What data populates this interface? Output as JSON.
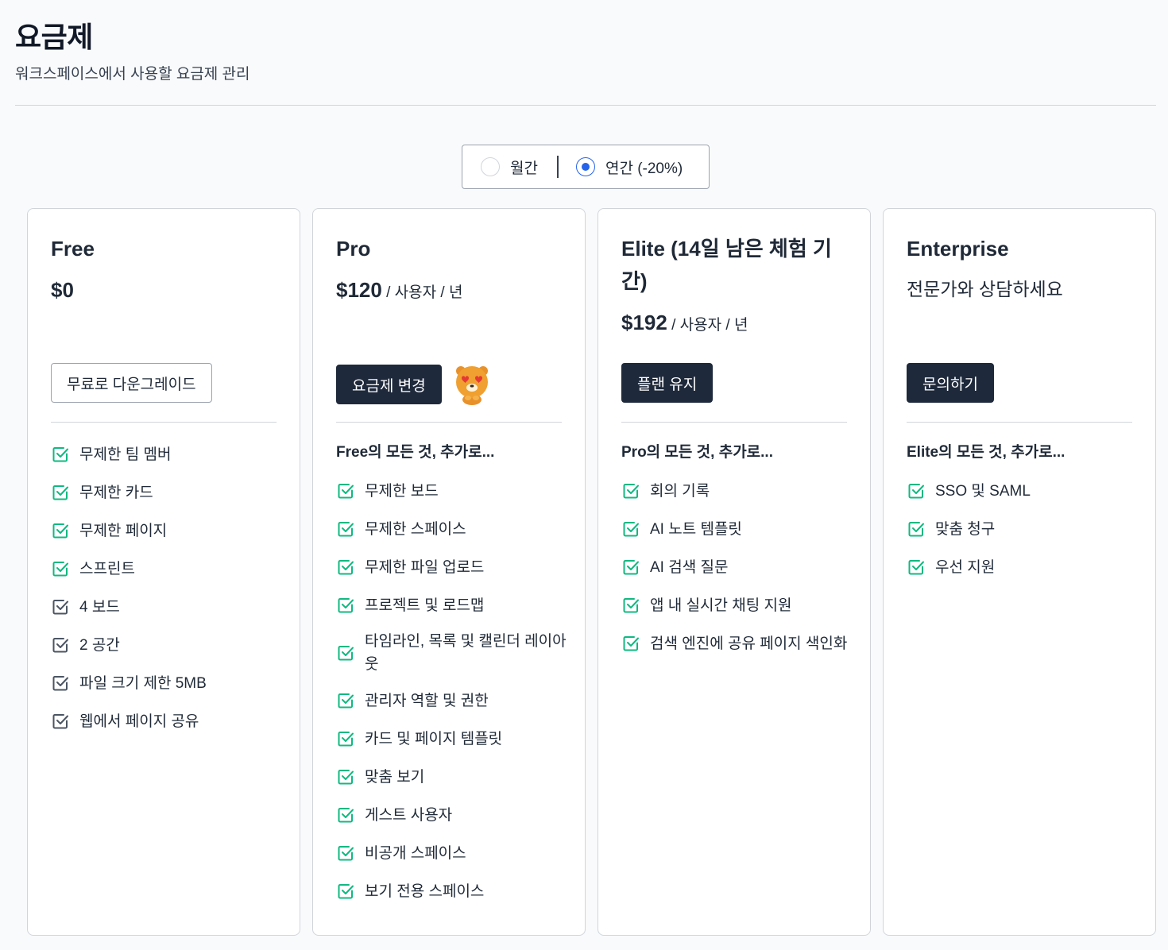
{
  "header": {
    "title": "요금제",
    "subtitle": "워크스페이스에서 사용할 요금제 관리"
  },
  "billing": {
    "monthly_label": "월간",
    "yearly_label": "연간 (-20%)",
    "selected": "yearly"
  },
  "colors": {
    "accent": "#2563eb",
    "check_green": "#10b981",
    "check_gray": "#4b5563",
    "dark_button": "#1e293b"
  },
  "plans": [
    {
      "name": "Free",
      "price_amount": "$0",
      "price_unit": "",
      "button_label": "무료로 다운그레이드",
      "features_intro": "",
      "features": [
        {
          "label": "무제한 팀 멤버",
          "icon": "check-square-green-icon"
        },
        {
          "label": "무제한 카드",
          "icon": "check-square-green-icon"
        },
        {
          "label": "무제한 페이지",
          "icon": "check-square-green-icon"
        },
        {
          "label": "스프린트",
          "icon": "check-square-green-icon"
        },
        {
          "label": "4 보드",
          "icon": "check-square-gray-icon"
        },
        {
          "label": "2 공간",
          "icon": "check-square-gray-icon"
        },
        {
          "label": "파일 크기 제한 5MB",
          "icon": "check-square-gray-icon"
        },
        {
          "label": "웹에서 페이지 공유",
          "icon": "check-square-gray-icon"
        }
      ]
    },
    {
      "name": "Pro",
      "price_amount": "$120",
      "price_unit": " / 사용자 / 년",
      "button_label": "요금제 변경",
      "mascot_icon": "heart-eyes-bear-icon",
      "features_intro": "Free의 모든 것, 추가로...",
      "features": [
        {
          "label": "무제한 보드",
          "icon": "check-square-green-icon"
        },
        {
          "label": "무제한 스페이스",
          "icon": "check-square-green-icon"
        },
        {
          "label": "무제한 파일 업로드",
          "icon": "check-square-green-icon"
        },
        {
          "label": "프로젝트 및 로드맵",
          "icon": "check-square-green-icon"
        },
        {
          "label": "타임라인, 목록 및 캘린더 레이아웃",
          "icon": "check-square-green-icon"
        },
        {
          "label": "관리자 역할 및 권한",
          "icon": "check-square-green-icon"
        },
        {
          "label": "카드 및 페이지 템플릿",
          "icon": "check-square-green-icon"
        },
        {
          "label": "맞춤 보기",
          "icon": "check-square-green-icon"
        },
        {
          "label": "게스트 사용자",
          "icon": "check-square-green-icon"
        },
        {
          "label": "비공개 스페이스",
          "icon": "check-square-green-icon"
        },
        {
          "label": "보기 전용 스페이스",
          "icon": "check-square-green-icon"
        }
      ]
    },
    {
      "name": "Elite (14일 남은 체험 기간)",
      "price_amount": "$192",
      "price_unit": " / 사용자 / 년",
      "button_label": "플랜 유지",
      "features_intro": "Pro의 모든 것, 추가로...",
      "features": [
        {
          "label": "회의 기록",
          "icon": "check-square-green-icon"
        },
        {
          "label": "AI 노트 템플릿",
          "icon": "check-square-green-icon"
        },
        {
          "label": "AI 검색 질문",
          "icon": "check-square-green-icon"
        },
        {
          "label": "앱 내 실시간 채팅 지원",
          "icon": "check-square-green-icon"
        },
        {
          "label": "검색 엔진에 공유 페이지 색인화",
          "icon": "check-square-green-icon"
        }
      ]
    },
    {
      "name": "Enterprise",
      "price_text": "전문가와 상담하세요",
      "button_label": "문의하기",
      "features_intro": "Elite의 모든 것, 추가로...",
      "features": [
        {
          "label": "SSO 및 SAML",
          "icon": "check-square-green-icon"
        },
        {
          "label": "맞춤 청구",
          "icon": "check-square-green-icon"
        },
        {
          "label": "우선 지원",
          "icon": "check-square-green-icon"
        }
      ]
    }
  ]
}
